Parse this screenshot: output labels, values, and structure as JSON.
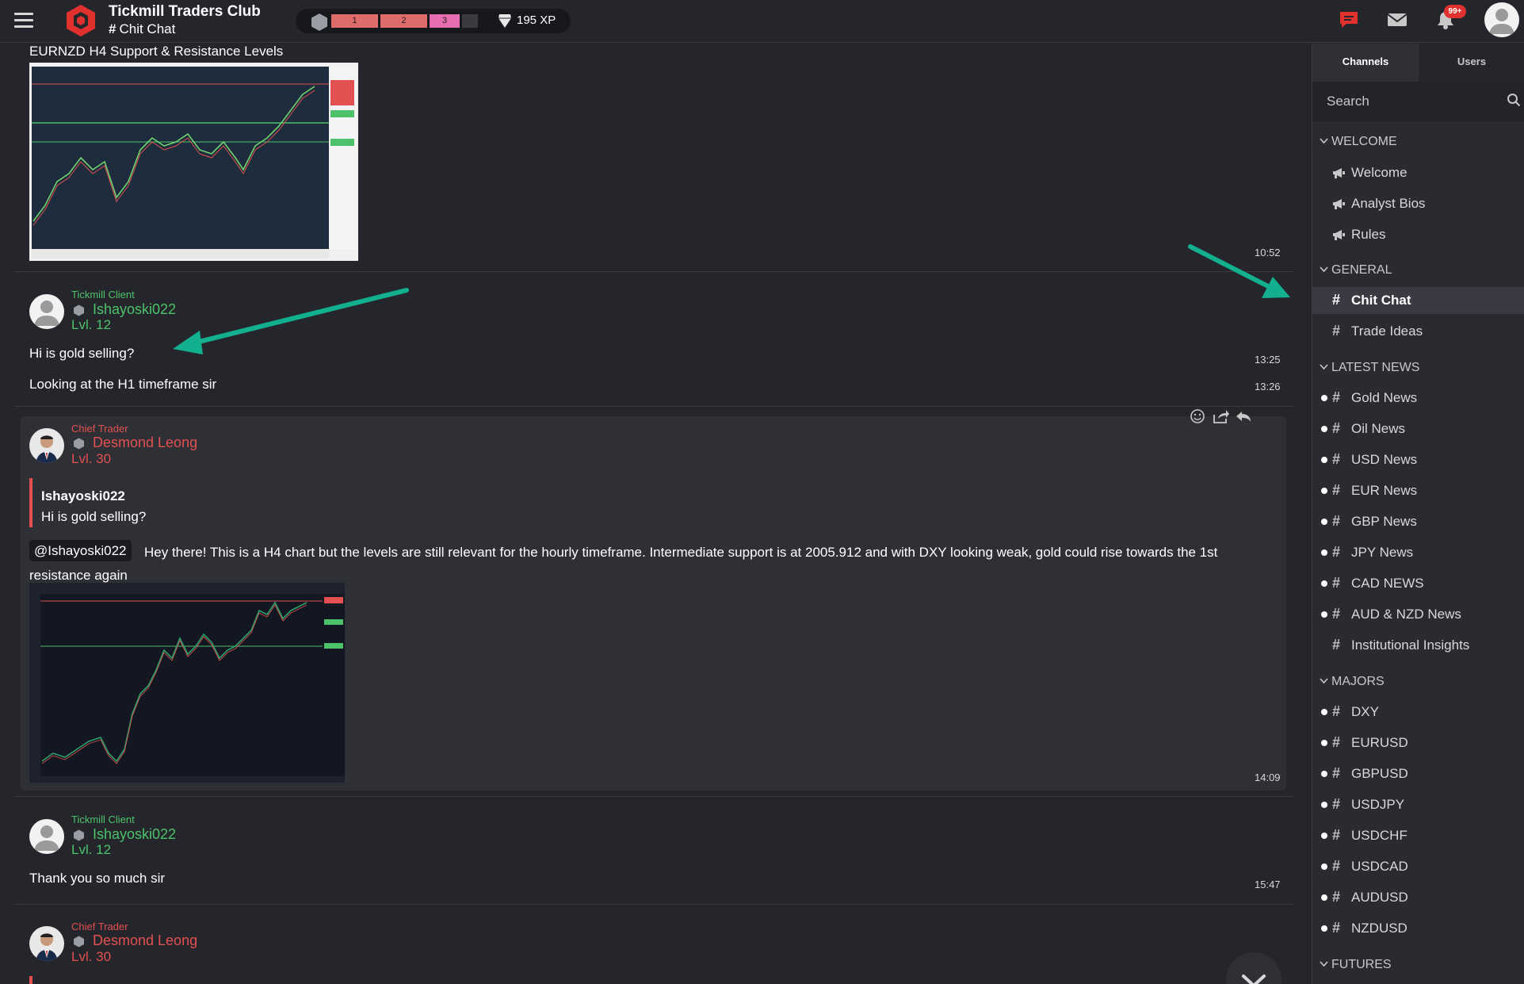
{
  "app": {
    "title": "Tickmill Traders Club",
    "channel": "Chit Chat",
    "xp": "195 XP",
    "notif_count": "99+",
    "level_segments": [
      "1",
      "2",
      "3"
    ],
    "accent": "#00b89f"
  },
  "messages": [
    {
      "title": "EURNZD H4 Support & Resistance Levels",
      "time": "10:52"
    },
    {
      "role": "Tickmill Client",
      "user": "Ishayoski022",
      "level": "Lvl. 12",
      "lines": [
        {
          "text": "Hi is gold selling?",
          "time": "13:25"
        },
        {
          "text": "Looking at the H1 timeframe sir",
          "time": "13:26"
        }
      ]
    },
    {
      "role": "Chief Trader",
      "user": "Desmond Leong",
      "level": "Lvl. 30",
      "quote_user": "Ishayoski022",
      "quote_text": "Hi is gold selling?",
      "mention": "@Ishayoski022",
      "text": "Hey there! This is a H4 chart but the levels are still relevant for the hourly timeframe. Intermediate support is at 2005.912 and with DXY looking weak, gold could rise towards the 1st resistance again",
      "time": "14:09"
    },
    {
      "role": "Tickmill Client",
      "user": "Ishayoski022",
      "level": "Lvl. 12",
      "text": "Thank you so much sir",
      "time": "15:47"
    },
    {
      "role": "Chief Trader",
      "user": "Desmond Leong",
      "level": "Lvl. 30"
    }
  ],
  "sidebar": {
    "tabs": [
      "Channels",
      "Users"
    ],
    "search_placeholder": "Search",
    "sections": [
      {
        "label": "WELCOME",
        "items": [
          {
            "label": "Welcome",
            "icon": "megaphone-icon"
          },
          {
            "label": "Analyst Bios",
            "icon": "megaphone-icon"
          },
          {
            "label": "Rules",
            "icon": "megaphone-icon"
          }
        ]
      },
      {
        "label": "GENERAL",
        "items": [
          {
            "label": "Chit Chat",
            "icon": "hash-icon",
            "active": true
          },
          {
            "label": "Trade Ideas",
            "icon": "hash-icon"
          }
        ]
      },
      {
        "label": "LATEST NEWS",
        "items": [
          {
            "label": "Gold News",
            "unread": true
          },
          {
            "label": "Oil News",
            "unread": true
          },
          {
            "label": "USD News",
            "unread": true
          },
          {
            "label": "EUR News",
            "unread": true
          },
          {
            "label": "GBP News",
            "unread": true
          },
          {
            "label": "JPY News",
            "unread": true
          },
          {
            "label": "CAD NEWS",
            "unread": true
          },
          {
            "label": "AUD & NZD News",
            "unread": true
          },
          {
            "label": "Institutional Insights",
            "unread": false
          }
        ]
      },
      {
        "label": "MAJORS",
        "items": [
          {
            "label": "DXY",
            "unread": true
          },
          {
            "label": "EURUSD",
            "unread": true
          },
          {
            "label": "GBPUSD",
            "unread": true
          },
          {
            "label": "USDJPY",
            "unread": true
          },
          {
            "label": "USDCHF",
            "unread": true
          },
          {
            "label": "USDCAD",
            "unread": true
          },
          {
            "label": "AUDUSD",
            "unread": true
          },
          {
            "label": "NZDUSD",
            "unread": true
          }
        ]
      },
      {
        "label": "FUTURES",
        "items": []
      }
    ]
  }
}
